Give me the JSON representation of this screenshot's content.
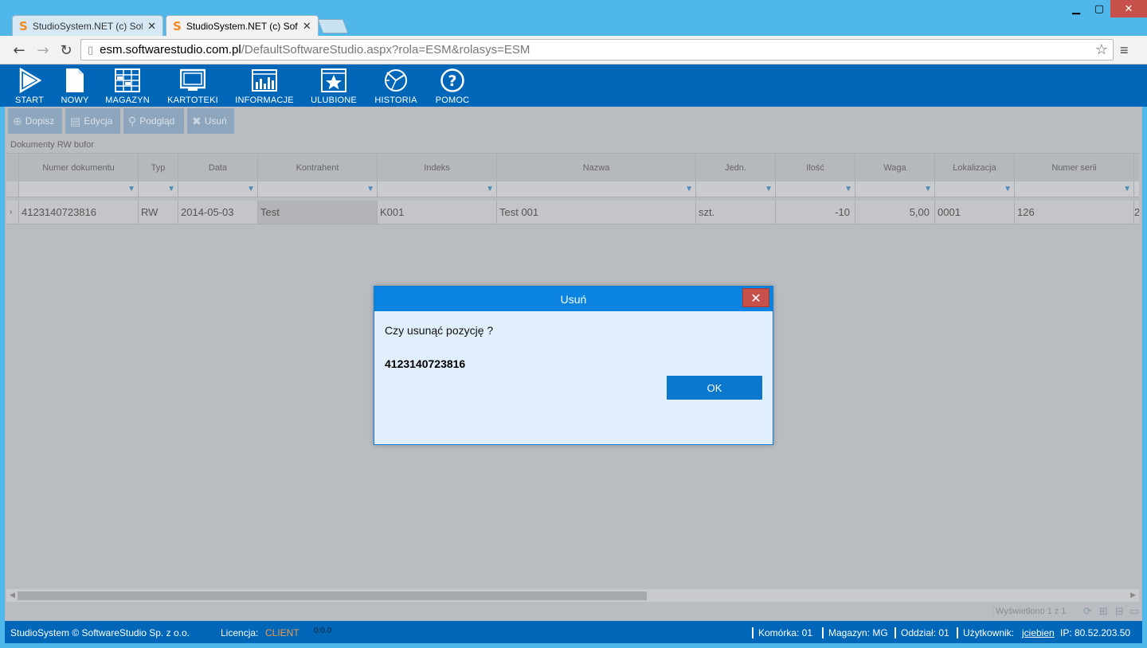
{
  "browser": {
    "tabs": [
      {
        "title": "StudioSystem.NET (c) Soft"
      },
      {
        "title": "StudioSystem.NET (c) Soft"
      }
    ],
    "url_host": "esm.softwarestudio.com.pl",
    "url_path": "/DefaultSoftwareStudio.aspx?rola=ESM&rolasys=ESM"
  },
  "appmenu": [
    {
      "label": "START",
      "icon": "play-icon"
    },
    {
      "label": "NOWY",
      "icon": "new-document-icon"
    },
    {
      "label": "MAGAZYN",
      "icon": "warehouse-grid-icon"
    },
    {
      "label": "KARTOTEKI",
      "icon": "monitor-icon"
    },
    {
      "label": "INFORMACJE",
      "icon": "bar-chart-icon"
    },
    {
      "label": "ULUBIONE",
      "icon": "star-icon"
    },
    {
      "label": "HISTORIA",
      "icon": "history-icon"
    },
    {
      "label": "POMOC",
      "icon": "help-icon"
    }
  ],
  "actions": [
    {
      "label": "Dopisz",
      "icon": "plus-icon"
    },
    {
      "label": "Edycja",
      "icon": "edit-icon"
    },
    {
      "label": "Podgląd",
      "icon": "magnifier-icon"
    },
    {
      "label": "Usuń",
      "icon": "delete-icon"
    }
  ],
  "grid": {
    "title": "Dokumenty RW bufor",
    "columns": [
      "Numer dokumentu",
      "Typ",
      "Data",
      "Kontrahent",
      "Indeks",
      "Nazwa",
      "Jedn.",
      "Ilość",
      "Waga",
      "Lokalizacja",
      "Numer serii"
    ],
    "row": [
      "4123140723816",
      "RW",
      "2014-05-03",
      "Test",
      "K001",
      "Test 001",
      "szt.",
      "-10",
      "5,00",
      "0001",
      "126"
    ],
    "overflow_value": "2"
  },
  "pager": {
    "text": "Wyświetlono 1 z 1"
  },
  "status": {
    "app": "StudioSystem © SoftwareStudio Sp. z o.o.",
    "license_label": "Licencja:",
    "license_value": "CLIENT",
    "timer": "0:0.0",
    "komorka": "Komórka: 01",
    "magazyn": "Magazyn: MG",
    "oddzial": "Oddział: 01",
    "user_label": "Użytkownik:",
    "user": "jciebien",
    "ip": "IP: 80.52.203.50"
  },
  "dialog": {
    "title": "Usuń",
    "question": "Czy usunąć pozycję ?",
    "document_number": "4123140723816",
    "ok_label": "OK"
  },
  "colors": {
    "brand": "#0067b8",
    "dialog_header": "#0a84e0",
    "close": "#c7504a",
    "license": "#f29a4a"
  }
}
